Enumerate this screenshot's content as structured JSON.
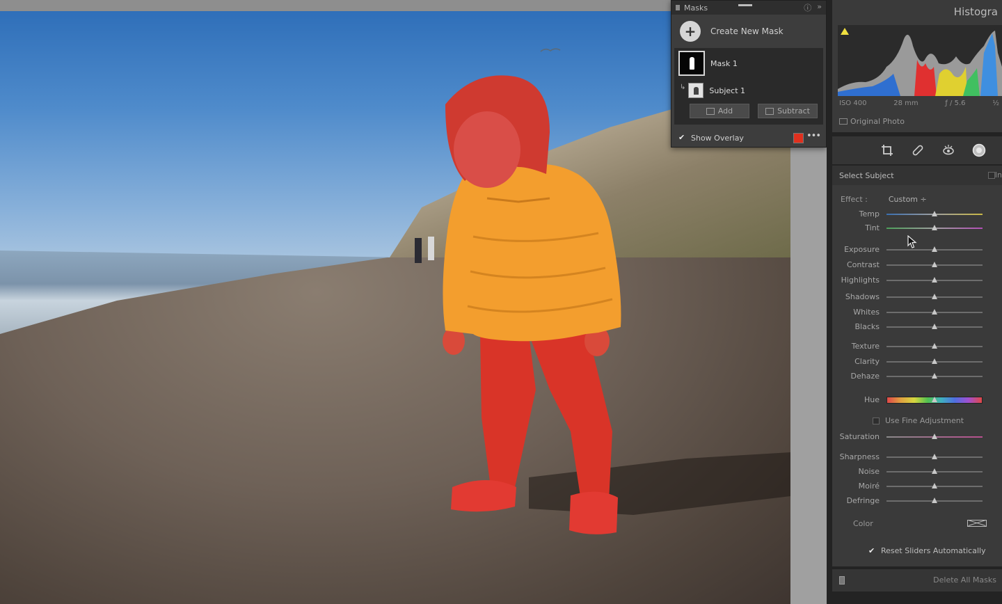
{
  "masks_panel": {
    "title": "Masks",
    "create_label": "Create New Mask",
    "mask_name": "Mask 1",
    "subject_name": "Subject 1",
    "add_label": "Add",
    "subtract_label": "Subtract",
    "show_overlay_label": "Show Overlay",
    "show_overlay_checked": true,
    "overlay_color": "#e0301e"
  },
  "histogram": {
    "title": "Histogra",
    "iso": "ISO 400",
    "focal": "28 mm",
    "aperture": "ƒ / 5.6",
    "shutter": "½",
    "original_photo_label": "Original Photo"
  },
  "tools": [
    "crop-icon",
    "heal-icon",
    "redeye-icon",
    "mask-icon"
  ],
  "adjust": {
    "header": "Select Subject",
    "header_right": "In",
    "effect_label": "Effect :",
    "effect_value": "Custom ÷",
    "sliders": [
      {
        "label": "Temp",
        "value": 0
      },
      {
        "label": "Tint",
        "value": 0
      },
      {
        "label": "Exposure",
        "value": 0
      },
      {
        "label": "Contrast",
        "value": 0
      },
      {
        "label": "Highlights",
        "value": 0
      },
      {
        "label": "Shadows",
        "value": 0
      },
      {
        "label": "Whites",
        "value": 0
      },
      {
        "label": "Blacks",
        "value": 0
      },
      {
        "label": "Texture",
        "value": 0
      },
      {
        "label": "Clarity",
        "value": 0
      },
      {
        "label": "Dehaze",
        "value": 0
      },
      {
        "label": "Hue",
        "value": 0
      },
      {
        "label": "Saturation",
        "value": 0
      },
      {
        "label": "Sharpness",
        "value": 0
      },
      {
        "label": "Noise",
        "value": 0
      },
      {
        "label": "Moiré",
        "value": 0
      },
      {
        "label": "Defringe",
        "value": 0
      }
    ],
    "fine_adjust_label": "Use Fine Adjustment",
    "color_label": "Color",
    "reset_label": "Reset Sliders Automatically",
    "reset_checked": true
  },
  "footer": {
    "delete_label": "Delete All Masks"
  }
}
